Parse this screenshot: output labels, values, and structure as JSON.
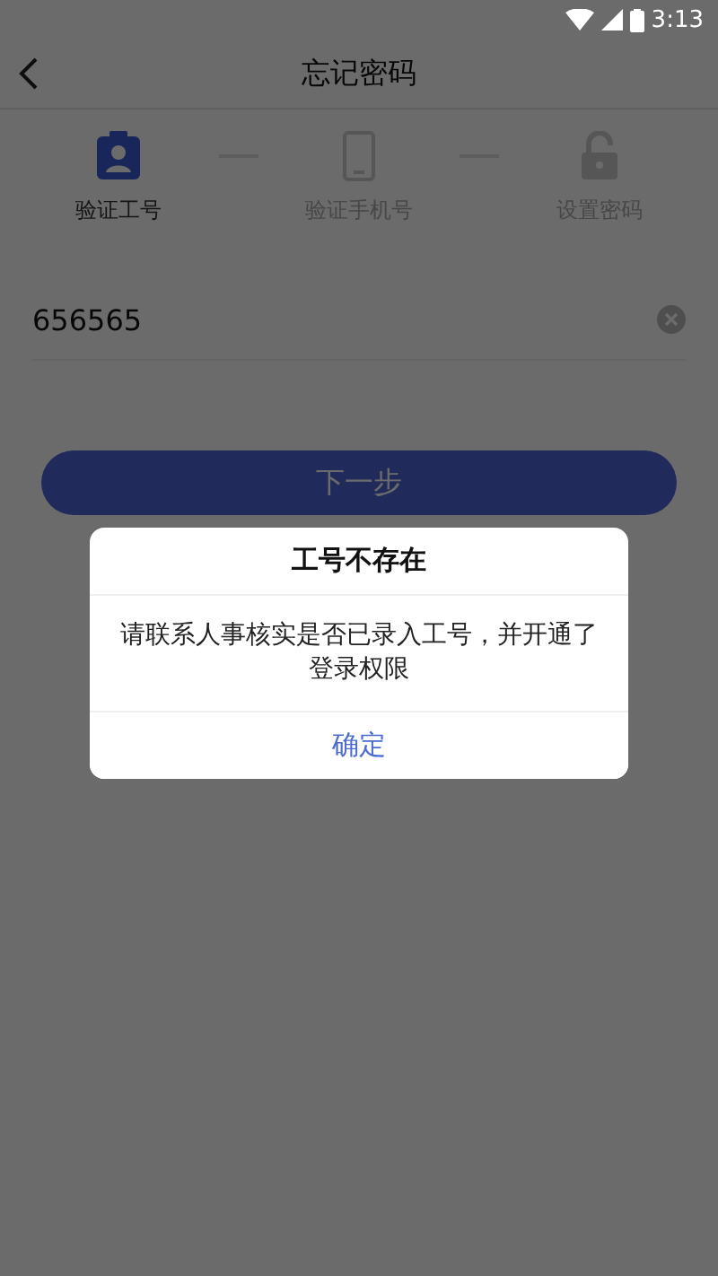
{
  "status_bar": {
    "time": "3:13"
  },
  "header": {
    "title": "忘记密码"
  },
  "steps": [
    {
      "label": "验证工号",
      "kind": "badge",
      "selected": true
    },
    {
      "label": "验证手机号",
      "kind": "phone",
      "selected": false
    },
    {
      "label": "设置密码",
      "kind": "lock",
      "selected": false
    }
  ],
  "employee_field": {
    "value": "656565"
  },
  "next_button": {
    "label": "下一步"
  },
  "dialog": {
    "title": "工号不存在",
    "message": "请联系人事核实是否已录入工号，并开通了登录权限",
    "button": "确定"
  }
}
